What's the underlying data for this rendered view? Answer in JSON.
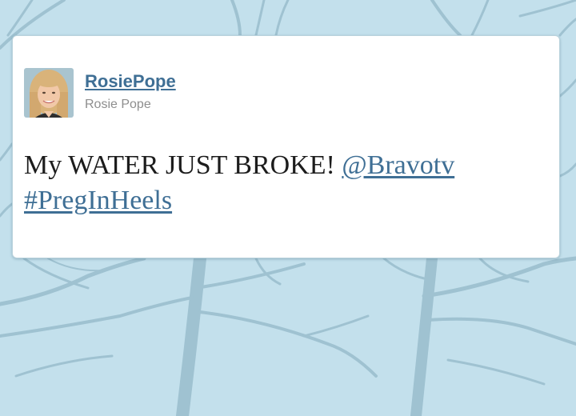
{
  "background": {
    "color": "#c3e0ec",
    "pattern": "bare-tree-branches"
  },
  "tweet": {
    "screen_name": "RosiePope",
    "full_name": "Rosie Pope",
    "avatar_icon": "profile-photo",
    "text": "My WATER JUST BROKE!",
    "mention": "@Bravotv",
    "hashtag": "#PregInHeels",
    "link_color": "#3f6f95"
  }
}
